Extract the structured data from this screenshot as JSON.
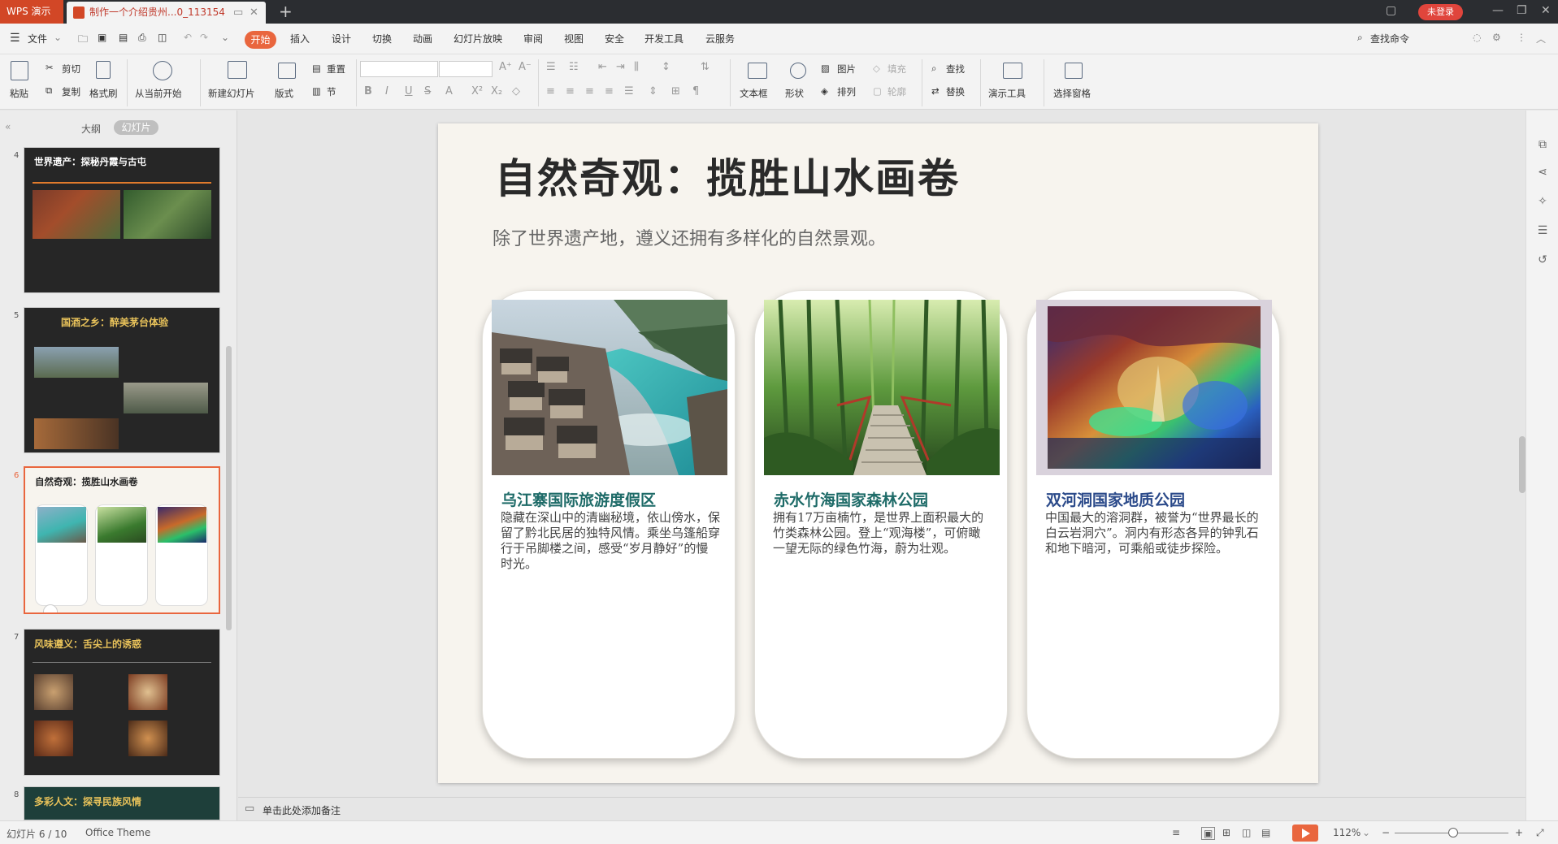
{
  "app": {
    "name": "WPS 演示",
    "doc_tab": "制作一个介绍贵州...0_113154",
    "login": "未登录"
  },
  "menu": {
    "file": "文件",
    "items": [
      "开始",
      "插入",
      "设计",
      "切换",
      "动画",
      "幻灯片放映",
      "审阅",
      "视图",
      "安全",
      "开发工具",
      "云服务"
    ],
    "search": "查找命令"
  },
  "ribbon": {
    "paste": "粘贴",
    "cut": "剪切",
    "copy": "复制",
    "format_painter": "格式刷",
    "from_current": "从当前开始",
    "new_slide": "新建幻灯片",
    "layout": "版式",
    "reset": "重置",
    "section": "节",
    "text_box": "文本框",
    "shape": "形状",
    "picture": "图片",
    "arrange": "排列",
    "fill": "填充",
    "outline": "轮廓",
    "find": "查找",
    "replace": "替换",
    "presentation_tools": "演示工具",
    "select_pane": "选择窗格"
  },
  "left_panel": {
    "outline_tab": "大纲",
    "slides_tab": "幻灯片",
    "thumbnails": [
      {
        "num": "4",
        "title": "世界遗产：探秘丹霞与古屯"
      },
      {
        "num": "5",
        "title": "国酒之乡：醉美茅台体验"
      },
      {
        "num": "6",
        "title": "自然奇观：揽胜山水画卷"
      },
      {
        "num": "7",
        "title": "风味遵义：舌尖上的诱惑"
      },
      {
        "num": "8",
        "title": "多彩人文：探寻民族风情"
      }
    ]
  },
  "slide": {
    "title": "自然奇观：揽胜山水画卷",
    "subtitle": "除了世界遗产地，遵义还拥有多样化的自然景观。",
    "cards": [
      {
        "title": "乌江寨国际旅游度假区",
        "desc": "隐藏在深山中的清幽秘境，依山傍水，保留了黔北民居的独特风情。乘坐乌篷船穿行于吊脚楼之间，感受“岁月静好”的慢时光。"
      },
      {
        "title": "赤水竹海国家森林公园",
        "desc": "拥有17万亩楠竹，是世界上面积最大的竹类森林公园。登上“观海楼”，可俯瞰一望无际的绿色竹海，蔚为壮观。"
      },
      {
        "title": "双河洞国家地质公园",
        "desc": "中国最大的溶洞群，被誉为“世界最长的白云岩洞穴”。洞内有形态各异的钟乳石和地下暗河，可乘船或徒步探险。"
      }
    ]
  },
  "notes": {
    "placeholder": "单击此处添加备注"
  },
  "status": {
    "slide_info": "幻灯片 6 / 10",
    "theme": "Office Theme",
    "zoom": "112%"
  },
  "colors": {
    "accent": "#e9663e",
    "card_title_teal": "#1e6b68",
    "card_title_blue": "#2b4a8a",
    "slide_bg": "#f7f4ee"
  }
}
